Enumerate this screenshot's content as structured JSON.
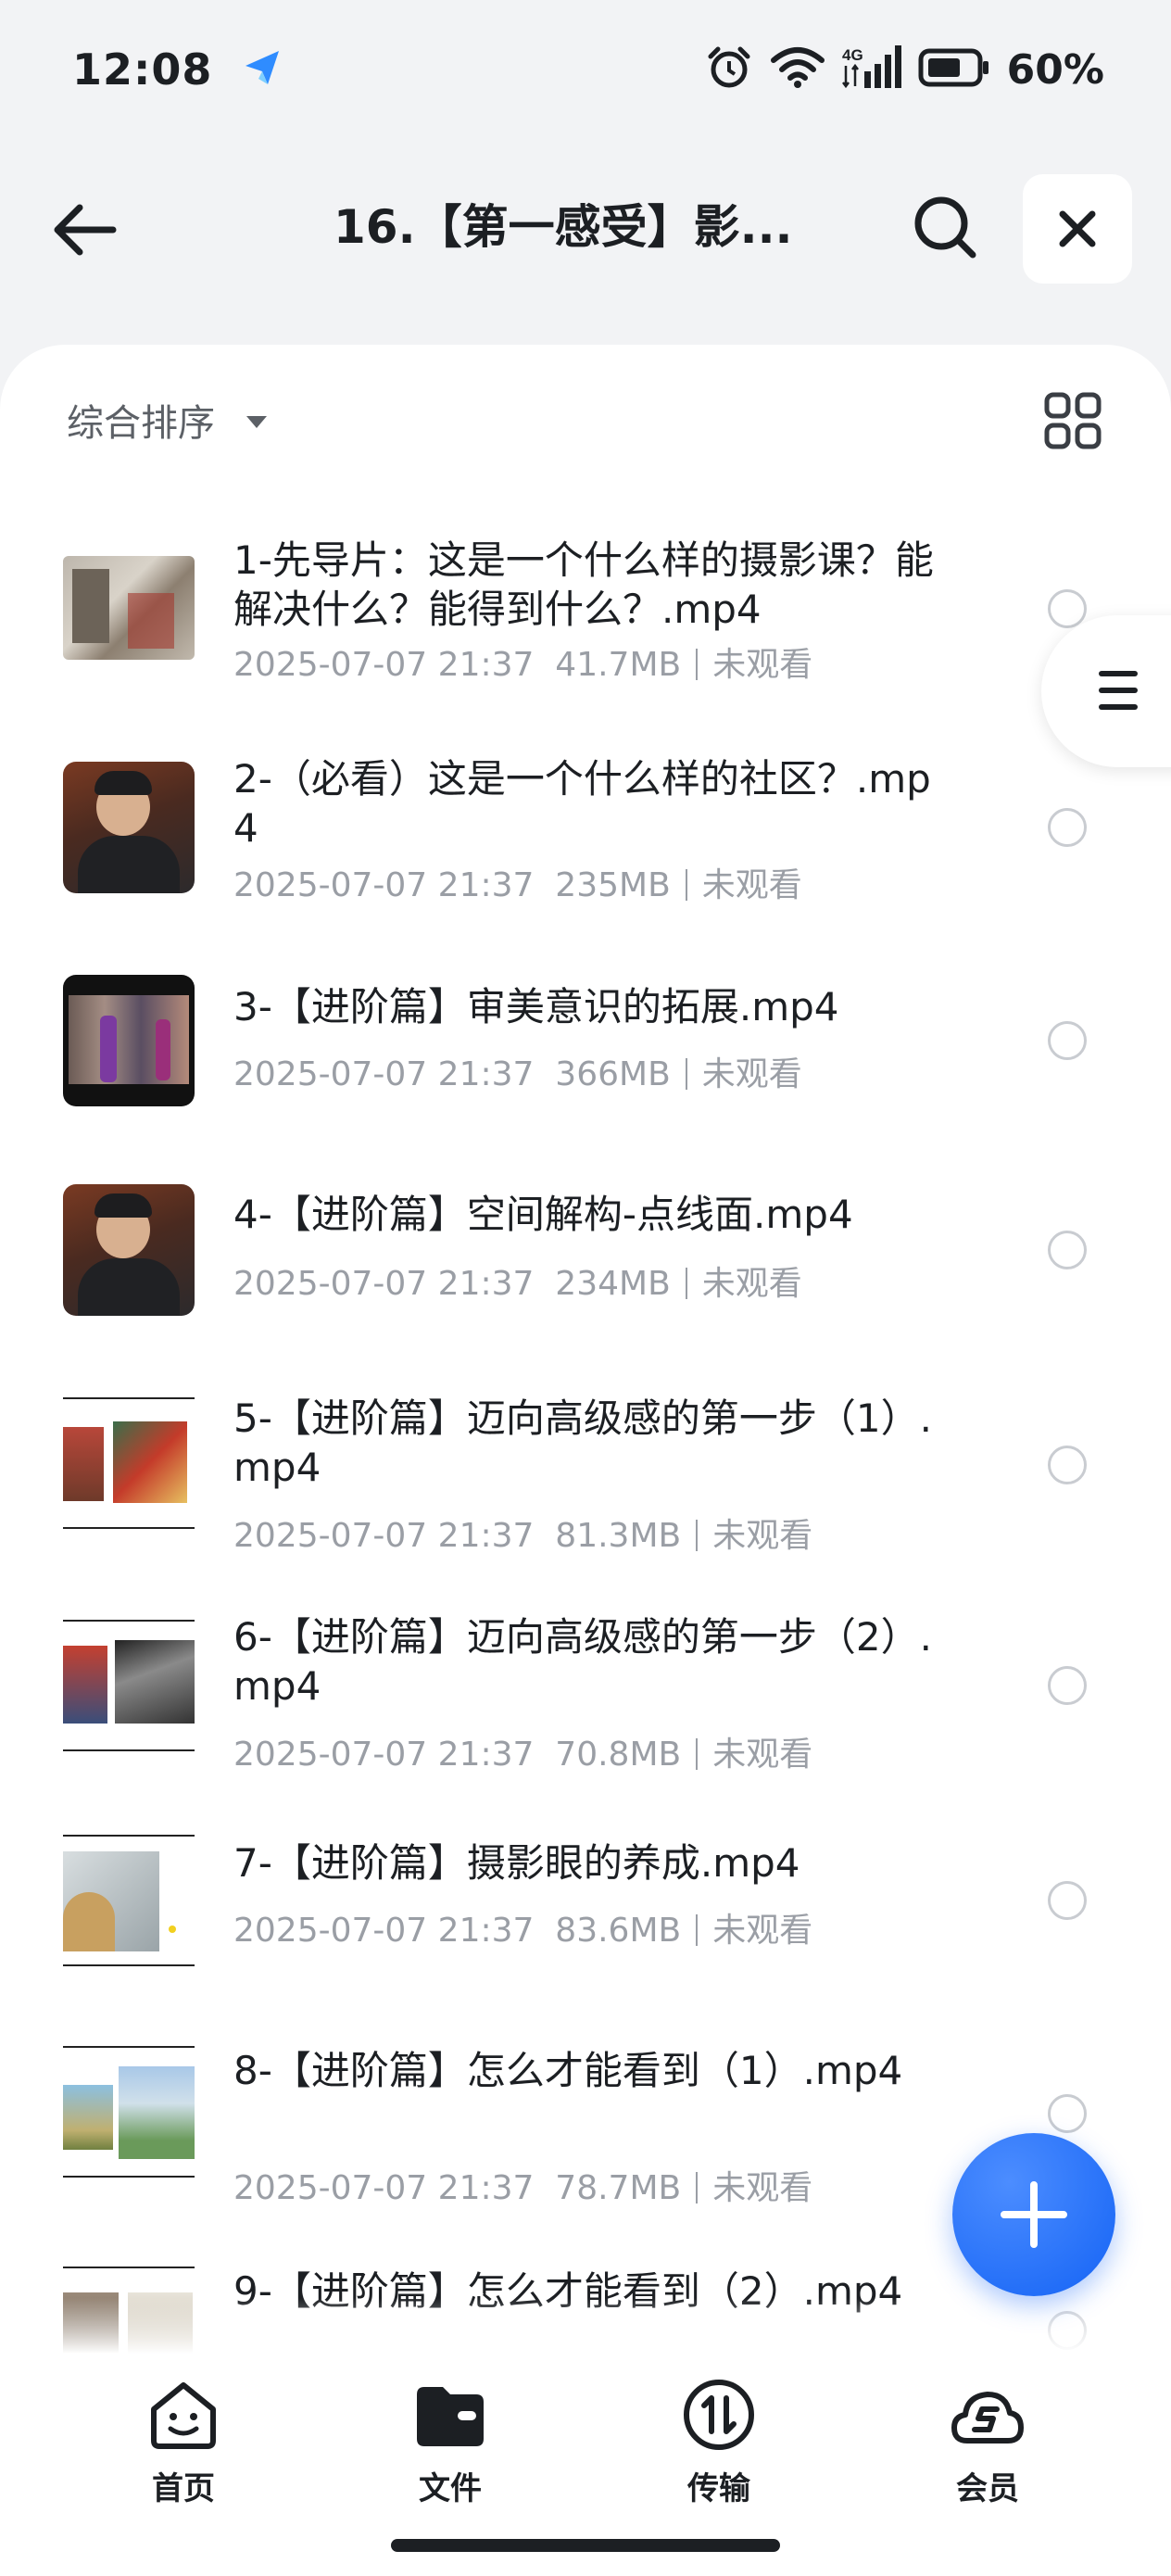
{
  "status_bar": {
    "time": "12:08",
    "network": "4G",
    "battery": "60%"
  },
  "header": {
    "title": "16.【第一感受】影...",
    "icons": [
      "back-arrow-icon",
      "search-icon",
      "close-icon"
    ]
  },
  "toolbar": {
    "sort_label": "综合排序",
    "view_toggle_icon": "grid-icon"
  },
  "files": [
    {
      "name": "1-先导片：这是一个什么样的摄影课？能解决什么？能得到什么？.mp4",
      "date": "2025-07-07 21:37",
      "size": "41.7MB",
      "status": "未观看"
    },
    {
      "name": "2-（必看）这是一个什么样的社区？.mp4",
      "date": "2025-07-07 21:37",
      "size": "235MB",
      "status": "未观看"
    },
    {
      "name": "3-【进阶篇】审美意识的拓展.mp4",
      "date": "2025-07-07 21:37",
      "size": "366MB",
      "status": "未观看"
    },
    {
      "name": "4-【进阶篇】空间解构-点线面.mp4",
      "date": "2025-07-07 21:37",
      "size": "234MB",
      "status": "未观看"
    },
    {
      "name": "5-【进阶篇】迈向高级感的第一步（1）.mp4",
      "date": "2025-07-07 21:37",
      "size": "81.3MB",
      "status": "未观看"
    },
    {
      "name": "6-【进阶篇】迈向高级感的第一步（2）.mp4",
      "date": "2025-07-07 21:37",
      "size": "70.8MB",
      "status": "未观看"
    },
    {
      "name": "7-【进阶篇】摄影眼的养成.mp4",
      "date": "2025-07-07 21:37",
      "size": "83.6MB",
      "status": "未观看"
    },
    {
      "name": "8-【进阶篇】怎么才能看到（1）.mp4",
      "date": "2025-07-07 21:37",
      "size": "78.7MB",
      "status": "未观看"
    },
    {
      "name": "9-【进阶篇】怎么才能看到（2）.mp4",
      "date": "",
      "size": "",
      "status": ""
    }
  ],
  "tabs": [
    {
      "label": "首页",
      "icon": "home-face-icon"
    },
    {
      "label": "文件",
      "icon": "folder-icon"
    },
    {
      "label": "传输",
      "icon": "transfer-icon"
    },
    {
      "label": "会员",
      "icon": "vip-cloud-icon"
    }
  ],
  "colors": {
    "accent": "#1463f5",
    "background": "#f2f3f5",
    "card": "#ffffff",
    "meta_text": "#9a9ea5"
  }
}
